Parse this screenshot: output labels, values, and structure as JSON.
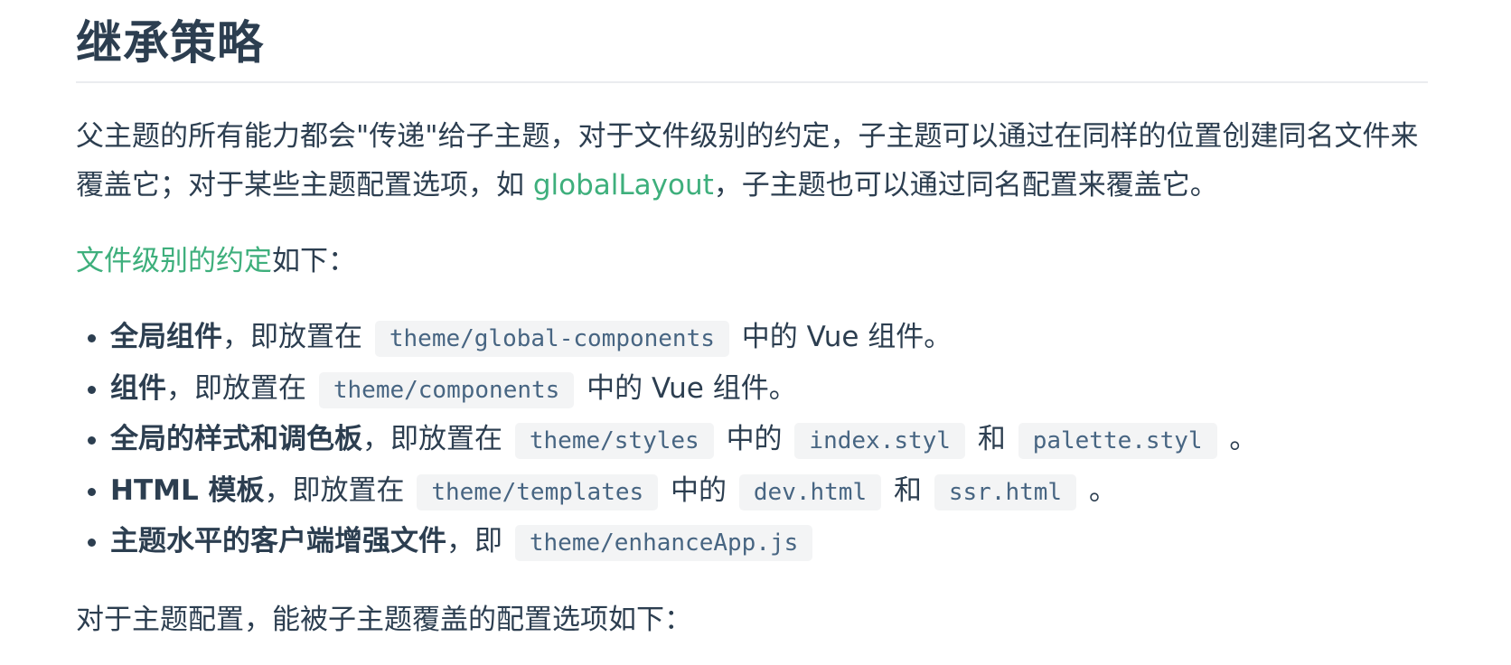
{
  "heading": "继承策略",
  "intro": {
    "part1": "父主题的所有能力都会\"传递\"给子主题，对于文件级别的约定，子主题可以通过在同样的位置创建同名文件来覆盖它；对于某些主题配置选项，如 ",
    "link": "globalLayout",
    "part2": "，子主题也可以通过同名配置来覆盖它。"
  },
  "files_intro": {
    "link": "文件级别的约定",
    "rest": "如下："
  },
  "list": [
    {
      "bold": "全局组件",
      "t1": "，即放置在",
      "c1": "theme/global-components",
      "t2": "中的 Vue 组件。"
    },
    {
      "bold": "组件",
      "t1": "，即放置在",
      "c1": "theme/components",
      "t2": "中的 Vue 组件。"
    },
    {
      "bold": "全局的样式和调色板",
      "t1": "，即放置在",
      "c1": "theme/styles",
      "t2": "中的",
      "c2": "index.styl",
      "t3": "和",
      "c3": "palette.styl",
      "t4": "。"
    },
    {
      "bold": "HTML 模板",
      "t1": "，即放置在",
      "c1": "theme/templates",
      "t2": "中的",
      "c2": "dev.html",
      "t3": "和",
      "c3": "ssr.html",
      "t4": "。"
    },
    {
      "bold": "主题水平的客户端增强文件",
      "t1": "，即",
      "c1": "theme/enhanceApp.js"
    }
  ],
  "theme_config_intro": "对于主题配置，能被子主题覆盖的配置选项如下：",
  "colors": {
    "text": "#2c3e50",
    "link": "#3eaf7c",
    "code_text": "#476582",
    "code_bg": "#f3f4f5",
    "divider": "#eaecef"
  }
}
